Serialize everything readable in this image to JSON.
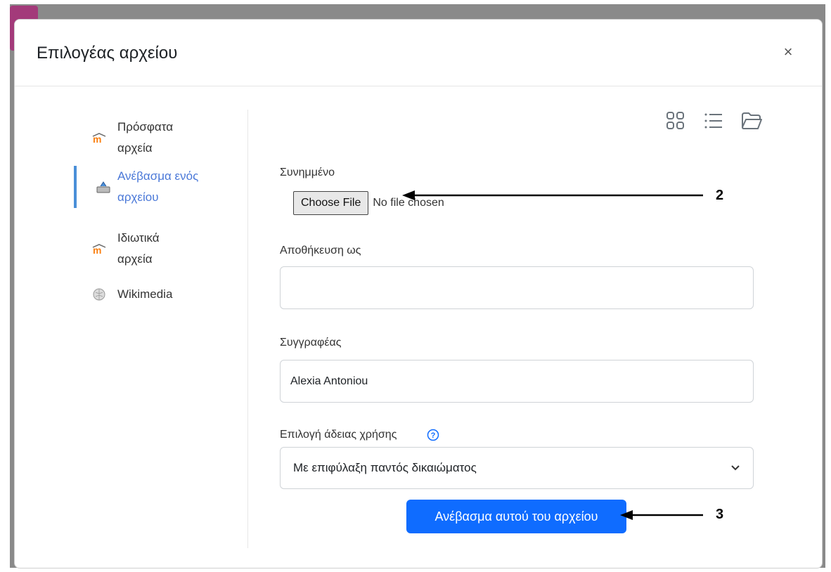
{
  "modal": {
    "title": "Επιλογέας αρχείου",
    "close_symbol": "×"
  },
  "sidebar": {
    "items": [
      {
        "label": "Πρόσφατα αρχεία",
        "icon": "moodle-icon",
        "active": false
      },
      {
        "label": "Ανέβασμα ενός αρχείου",
        "icon": "upload-icon",
        "active": true
      },
      {
        "label": "Ιδιωτικά αρχεία",
        "icon": "moodle-icon",
        "active": false
      },
      {
        "label": "Wikimedia",
        "icon": "wikimedia-icon",
        "active": false
      }
    ]
  },
  "view_icons": [
    "grid-view-icon",
    "list-view-icon",
    "folder-view-icon"
  ],
  "form": {
    "attachment_label": "Συνημμένο",
    "choose_file_label": "Choose File",
    "no_file_text": "No file chosen",
    "save_as_label": "Αποθήκευση ως",
    "save_as_value": "",
    "author_label": "Συγγραφέας",
    "author_value": "Alexia Antoniou",
    "license_label": "Επιλογή άδειας χρήσης",
    "license_value": "Με επιφύλαξη παντός δικαιώματος",
    "upload_button": "Ανέβασμα αυτού του αρχείου"
  },
  "annotations": [
    "2",
    "3"
  ],
  "colors": {
    "primary": "#0f6cff",
    "active_nav": "#4a78d8",
    "moodle_orange": "#f98012"
  }
}
